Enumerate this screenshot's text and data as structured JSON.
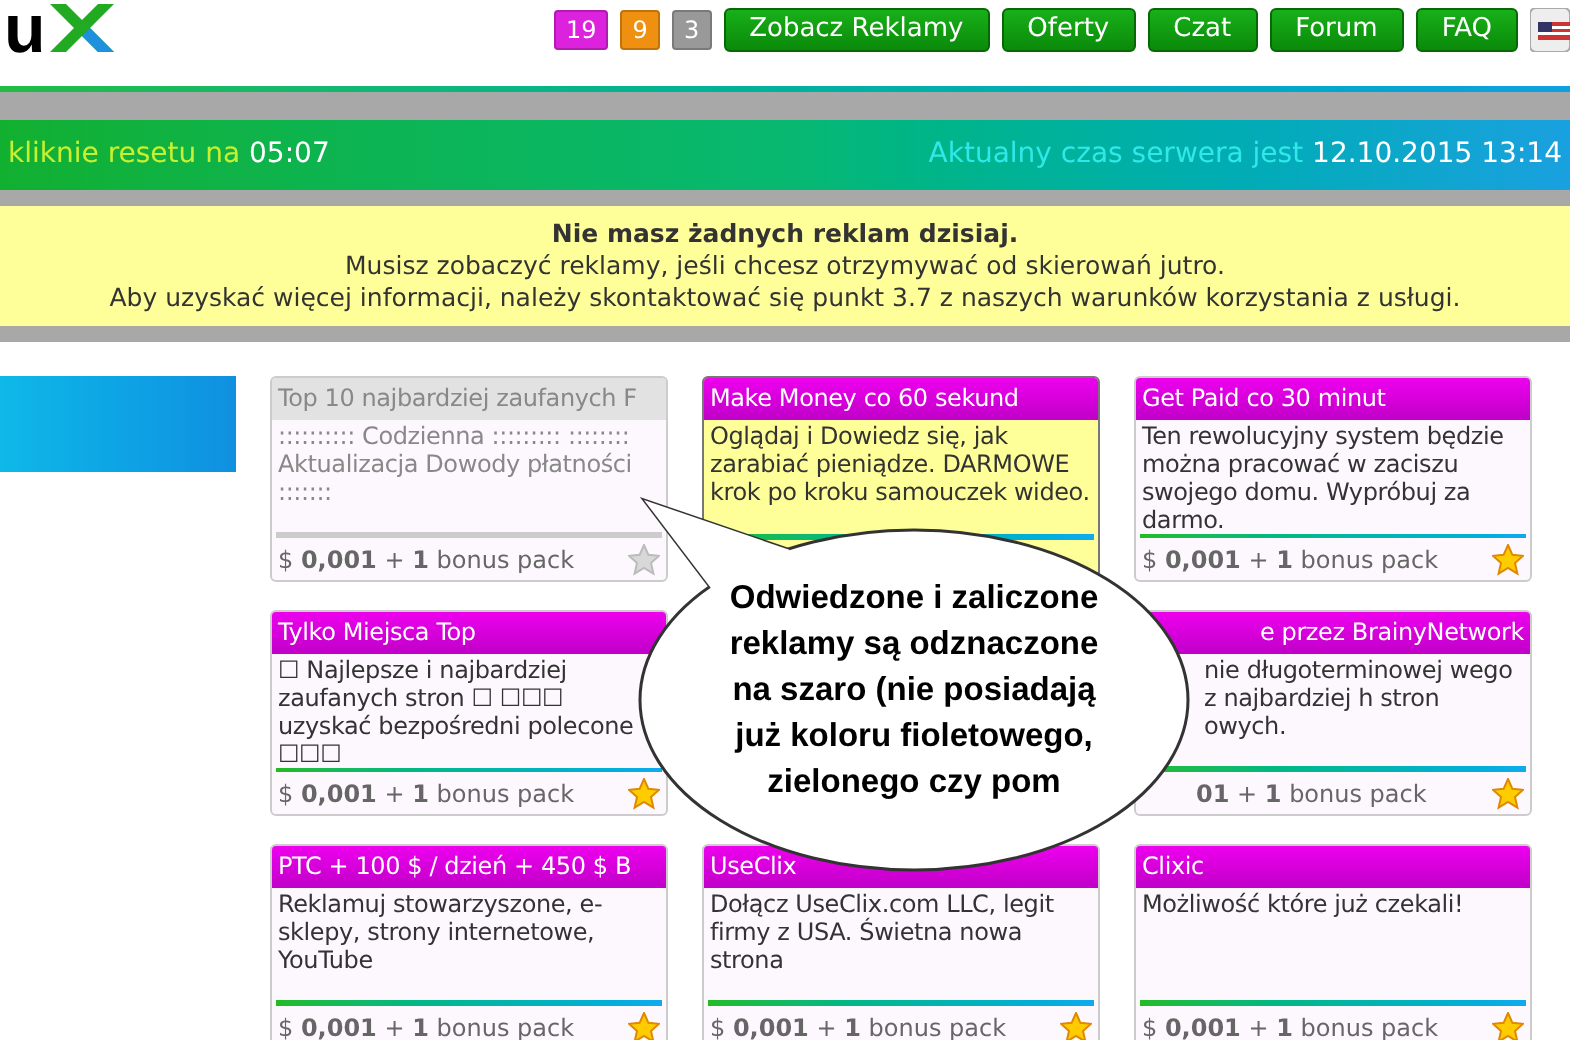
{
  "header": {
    "logo": "u",
    "badges": [
      {
        "text": "19",
        "color": "#dd22dd"
      },
      {
        "text": "9",
        "color": "#f09010"
      },
      {
        "text": "3",
        "color": "#999999"
      }
    ],
    "nav": [
      "Zobacz Reklamy",
      "Oferty",
      "Czat",
      "Forum",
      "FAQ"
    ]
  },
  "banner": {
    "reset_label": "kliknie resetu na",
    "reset_time": "05:07",
    "server_label": "Aktualny czas serwera jest",
    "server_time": "12.10.2015 13:14"
  },
  "notice": {
    "title": "Nie masz żadnych reklam dzisiaj.",
    "lines": [
      "Musisz zobaczyć reklamy, jeśli chcesz otrzymywać od skierowań jutro.",
      "Aby uzyskać więcej informacji, należy skontaktować się punkt 3.7 z naszych warunków korzystania z usługi."
    ]
  },
  "ads": [
    {
      "title": "Top 10 najbardziej zaufanych F",
      "body": ":::::::::: Codzienna ::::::::: :::::::: Aktualizacja Dowody płatności :::::::",
      "visited": true,
      "highlighted": false,
      "footer": "$ **0,001** + **1** bonus pack",
      "starred": false,
      "indent": false
    },
    {
      "title": "Make Money co 60 sekund",
      "body": "Oglądaj i Dowiedz się, jak zarabiać pieniądze. DARMOWE krok po kroku samouczek wideo.",
      "visited": false,
      "highlighted": true
    },
    {
      "title": "Get Paid co 30 minut",
      "body": "Ten rewolucyjny system będzie można pracować w zaciszu swojego domu. Wypróbuj za darmo.",
      "visited": false,
      "highlighted": false,
      "footer": "$ **0,001** + **1** bonus pack",
      "starred": true
    },
    {
      "title": "Tylko Miejsca Top",
      "body": "☐ Najlepsze i najbardziej zaufanych stron ☐ ☐☐☐ uzyskać bezpośredni polecone ☐☐☐",
      "visited": false,
      "highlighted": false,
      "footer": "$ **0,001** + **1** bonus pack",
      "starred": true,
      "indent": false
    },
    {
      "title": "e przez BrainyNetwork",
      "body": "nie długoterminowej wego z najbardziej h stron owych.",
      "visited": false,
      "highlighted": false,
      "footer": "**01** + **1** bonus pack",
      "starred": true,
      "indent": true
    },
    {
      "title": "PTC + 100 $ / dzień + 450 $ B",
      "body": "Reklamuj stowarzyszone, e-sklepy, strony internetowe, YouTube",
      "visited": false,
      "highlighted": false,
      "footer": "$ **0,001** + **1** bonus pack",
      "starred": true,
      "indent": false
    },
    {
      "title": "UseClix",
      "body": "Dołącz UseClix.com LLC, legit firmy z USA. Świetna nowa strona",
      "visited": false,
      "highlighted": false,
      "footer": "$ **0,001** + **1** bonus pack",
      "starred": true,
      "indent": false
    },
    {
      "title": "Clixic",
      "body": "Możliwość które już czekali!",
      "visited": false,
      "highlighted": false,
      "footer": "$ **0,001** + **1** bonus pack",
      "starred": true,
      "indent": false
    }
  ],
  "callout": "Odwiedzone i zaliczone reklamy są odznaczone na szaro (nie posiadają już koloru fioletowego, zielonego czy pom"
}
